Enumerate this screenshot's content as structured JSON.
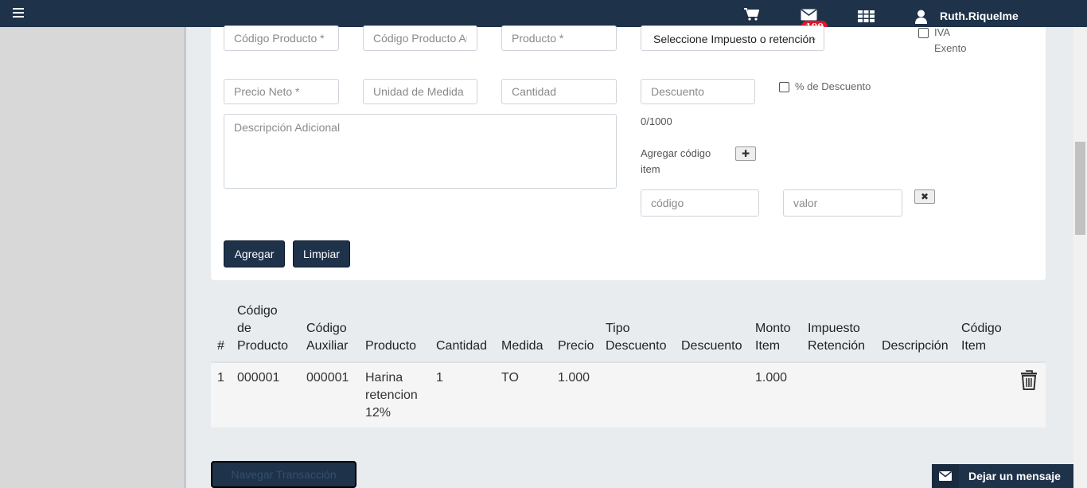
{
  "topbar": {
    "username": "Ruth.Riquelme",
    "notification_count": "100",
    "icons": [
      "menu-icon",
      "cart-icon",
      "mail-icon",
      "apps-grid-icon",
      "user-icon"
    ]
  },
  "form": {
    "codigo_producto_placeholder": "Código Producto *",
    "codigo_auxiliar_placeholder": "Código Producto Auxiliar",
    "producto_placeholder": "Producto *",
    "impuesto_select": "Seleccione Impuesto o retención",
    "iva_exento_label_1": "IVA",
    "iva_exento_label_2": "Exento",
    "precio_neto_placeholder": "Precio Neto *",
    "unidad_medida_placeholder": "Unidad de Medida",
    "cantidad_placeholder": "Cantidad",
    "descuento_placeholder": "Descuento",
    "porcentaje_descuento_label": "% de Descuento",
    "descripcion_placeholder": "Descripción Adicional",
    "char_counter": "0/1000",
    "agregar_codigo_label_1": "Agregar código",
    "agregar_codigo_label_2": "item",
    "codigo_placeholder": "código",
    "valor_placeholder": "valor",
    "agregar_button": "Agregar",
    "limpiar_button": "Limpiar"
  },
  "table": {
    "headers": {
      "num": "#",
      "codigo_producto": [
        "Código",
        "de",
        "Producto"
      ],
      "codigo_auxiliar": [
        "Código",
        "Auxiliar"
      ],
      "producto": "Producto",
      "cantidad": "Cantidad",
      "medida": "Medida",
      "precio": "Precio",
      "tipo_descuento": [
        "Tipo",
        "Descuento"
      ],
      "descuento": "Descuento",
      "monto_item": [
        "Monto",
        "Item"
      ],
      "impuesto_retencion": [
        "Impuesto",
        "Retención"
      ],
      "descripcion": "Descripción",
      "codigo_item": [
        "Código",
        "Item"
      ]
    },
    "rows": [
      {
        "num": "1",
        "codigo_producto": "000001",
        "codigo_auxiliar": "000001",
        "producto": [
          "Harina",
          "retencion",
          "12%"
        ],
        "cantidad": "1",
        "medida": "TO",
        "precio": "1.000",
        "monto_item": "1.000"
      }
    ]
  },
  "footer": {
    "navegar_button": "Navegar Transacción",
    "chat_label": "Dejar un mensaje"
  }
}
